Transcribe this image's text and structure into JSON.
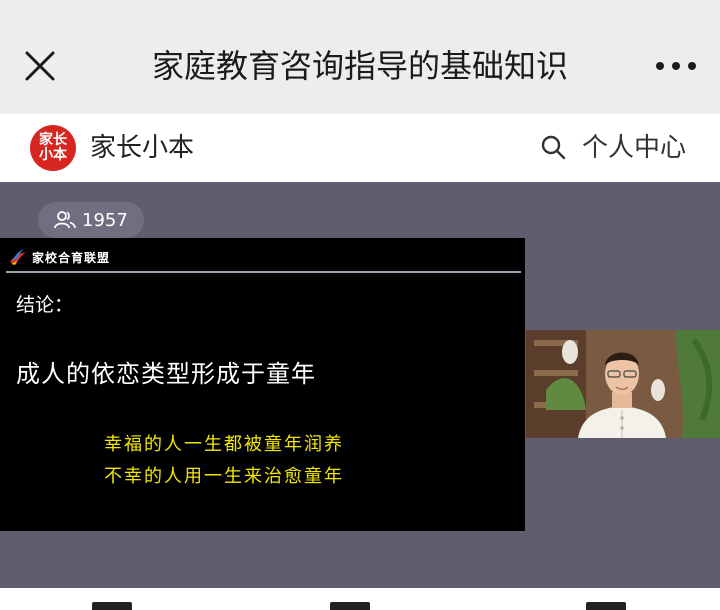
{
  "window": {
    "title": "家庭教育咨询指导的基础知识"
  },
  "channel": {
    "logo_text": "家长小本",
    "name": "家长小本",
    "personal_center": "个人中心"
  },
  "live": {
    "viewer_count": "1957"
  },
  "slide": {
    "brand": "家校合育联盟",
    "heading": "结论：",
    "main_line": "成人的依恋类型形成于童年",
    "line_1": "幸福的人一生都被童年润养",
    "line_2": "不幸的人用一生来治愈童年"
  },
  "colors": {
    "title_bar": "#ededed",
    "logo_red": "#d7261f",
    "player_bg": "#5e5e6e",
    "slide_yellow": "#f2e600"
  },
  "icons": [
    "close-icon",
    "more-icon",
    "search-icon",
    "people-icon"
  ]
}
